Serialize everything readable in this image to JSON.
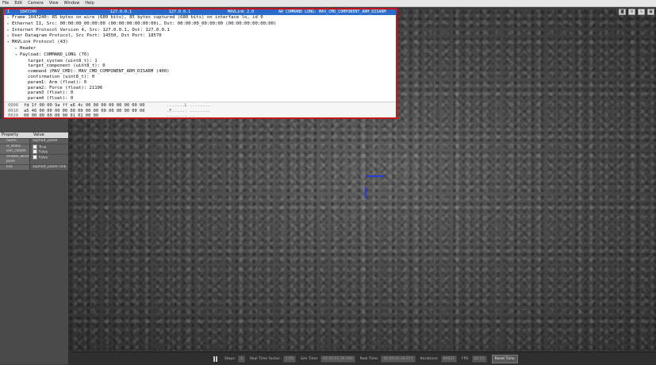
{
  "menubar": [
    "File",
    "Edit",
    "Camera",
    "View",
    "Window",
    "Help"
  ],
  "packet_row": {
    "no": "1",
    "time": "1847240",
    "source": "127.0.0.1",
    "destination": "127.0.0.1",
    "protocol": "MAVLink 2.0",
    "info": "AR COMMAND LONG: MAV_CMD_COMPONENT_ARM_DISARM"
  },
  "tree": [
    {
      "indent": 0,
      "arrow": "right",
      "text": "Frame 1847240: 85 bytes on wire (680 bits), 85 bytes captured (680 bits) on interface lo, id 0"
    },
    {
      "indent": 0,
      "arrow": "right",
      "text": "Ethernet II, Src: 00:00:00_00:00:00 (00:00:00:00:00:00), Dst: 00:00:00_00:00:00 (00:00:00:00:00:00)"
    },
    {
      "indent": 0,
      "arrow": "right",
      "text": "Internet Protocol Version 4, Src: 127.0.0.1, Dst: 127.0.0.1"
    },
    {
      "indent": 0,
      "arrow": "right",
      "text": "User Datagram Protocol, Src Port: 14550, Dst Port: 18570"
    },
    {
      "indent": 0,
      "arrow": "down",
      "text": "MAVLink Protocol (43)"
    },
    {
      "indent": 1,
      "arrow": "right",
      "text": "Header"
    },
    {
      "indent": 1,
      "arrow": "down",
      "text": "Payload: COMMAND_LONG (76)"
    },
    {
      "indent": 2,
      "arrow": "",
      "text": "target_system (uint8_t): 1"
    },
    {
      "indent": 2,
      "arrow": "",
      "text": "target_component (uint8_t): 0"
    },
    {
      "indent": 2,
      "arrow": "",
      "text": "command (MAV_CMD): MAV_CMD_COMPONENT_ARM_DISARM (400)"
    },
    {
      "indent": 2,
      "arrow": "",
      "text": "confirmation (uint8_t): 0"
    },
    {
      "indent": 2,
      "arrow": "",
      "text": "param1: Arm (float): 0"
    },
    {
      "indent": 2,
      "arrow": "",
      "text": "param2: Force (float): 21196"
    },
    {
      "indent": 2,
      "arrow": "",
      "text": "param3 (float): 0"
    },
    {
      "indent": 2,
      "arrow": "",
      "text": "param4 (float): 0"
    }
  ],
  "hex": [
    {
      "offset": "0000",
      "bytes": "fd 1f 00 00 9a ff e6 4c  00 00 00 00 00 00 00 00",
      "ascii": ".......L ........"
    },
    {
      "offset": "0010",
      "bytes": "a5 46 00 00 00 00 00 00  00 00 00 00 00 00 00 00",
      "ascii": ".F...... ........"
    },
    {
      "offset": "0020",
      "bytes": "00 00 00 00 00 90 01 01  00 00",
      "ascii": "........ .."
    }
  ],
  "properties": {
    "header_property": "Property",
    "header_value": "Value",
    "rows": [
      {
        "key": "name",
        "value": "asphalt_plane"
      },
      {
        "key": "is_static",
        "value": "True",
        "checkbox": true
      },
      {
        "key": "self_collide",
        "value": "False",
        "checkbox": true
      },
      {
        "key": "enable_wind",
        "value": "False",
        "checkbox": true
      },
      {
        "key": "pose",
        "value": ""
      },
      {
        "key": "link",
        "value": "asphalt_plane::link"
      }
    ]
  },
  "bottombar": {
    "steps_label": "Steps:",
    "steps_value": "1",
    "rtf_label": "Real Time Factor:",
    "rtf_value": "1.00",
    "simtime_label": "Sim Time:",
    "simtime_value": "00 00:01:36.940",
    "realtime_label": "Real Time:",
    "realtime_value": "00 00:01:34.677",
    "iterations_label": "Iterations:",
    "iterations_value": "96937",
    "fps_label": "FPS:",
    "fps_value": "62.51",
    "reset_label": "Reset Time"
  },
  "colors": {
    "selected_row": "#2b6cc8",
    "panel_border": "#c4161c",
    "axis": "#2a3ce0"
  }
}
